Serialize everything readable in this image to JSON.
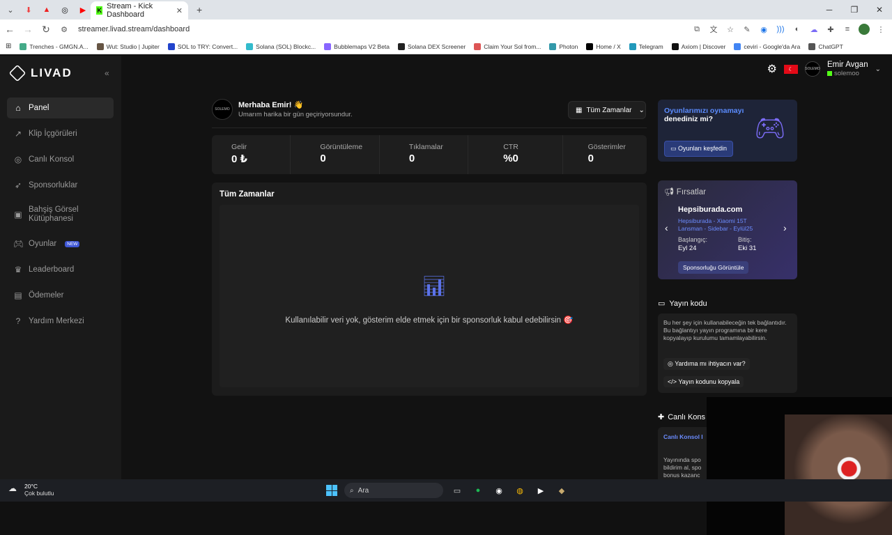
{
  "browser": {
    "tab_title": "Stream - Kick Dashboard",
    "url": "streamer.livad.stream/dashboard",
    "bookmarks": [
      "Trenches - GMGN.A...",
      "Wut: Studio | Jupiter",
      "SOL to TRY: Convert...",
      "Solana (SOL) Blockc...",
      "Bubblemaps V2 Beta",
      "Solana DEX Screener",
      "Claim Your Sol from...",
      "Photon",
      "Home / X",
      "Telegram",
      "Axiom | Discover",
      "ceviri - Google'da Ara",
      "ChatGPT"
    ]
  },
  "brand": "LIVAD",
  "sidebar": {
    "items": [
      {
        "label": "Panel",
        "icon": "home-icon"
      },
      {
        "label": "Klip İçgörüleri",
        "icon": "trend-icon"
      },
      {
        "label": "Canlı Konsol",
        "icon": "target-icon"
      },
      {
        "label": "Sponsorluklar",
        "icon": "rocket-icon"
      },
      {
        "label": "Bahşiş Görsel Kütüphanesi",
        "icon": "image-icon"
      },
      {
        "label": "Oyunlar",
        "icon": "gamepad-icon",
        "badge": "NEW"
      },
      {
        "label": "Leaderboard",
        "icon": "trophy-icon"
      },
      {
        "label": "Ödemeler",
        "icon": "wallet-icon"
      },
      {
        "label": "Yardım Merkezi",
        "icon": "help-icon"
      }
    ]
  },
  "user": {
    "name": "Emir Avgan",
    "handle": "solemoo",
    "avatar_text": "SOLEMO"
  },
  "greeting": {
    "title": "Merhaba Emir! 👋",
    "subtitle": "Umarım harika bir gün geçiriyorsundur."
  },
  "range_selector": "Tüm Zamanlar",
  "stats": [
    {
      "label": "Gelir",
      "value": "0 ₺"
    },
    {
      "label": "Görüntüleme",
      "value": "0"
    },
    {
      "label": "Tıklamalar",
      "value": "0"
    },
    {
      "label": "CTR",
      "value": "%0"
    },
    {
      "label": "Gösterimler",
      "value": "0"
    }
  ],
  "panel": {
    "title": "Tüm Zamanlar",
    "empty_text": "Kullanılabilir veri yok, gösterim elde etmek için bir sponsorluk kabul edebilirsin 🎯"
  },
  "promo": {
    "highlight": "Oyunlarımızı oynamayı",
    "rest": " denediniz mi?",
    "button": "Oyunları keşfedin"
  },
  "opportunities": {
    "title": "Fırsatlar",
    "brand": "Hepsiburada.com",
    "campaign": "Hepsiburada - Xiaomi 15T Lansman - Sidebar - Eylül25",
    "start_label": "Başlangıç:",
    "start_date": "Eyl 24",
    "end_label": "Bitiş:",
    "end_date": "Eki 31",
    "button": "Sponsorluğu Görüntüle"
  },
  "stream_code": {
    "title": "Yayın kodu",
    "desc": "Bu her şey için kullanabileceğin tek bağlantıdır. Bu bağlantıyı yayın programına bir kere kopyalayıp kurulumu tamamlayabilirsin.",
    "help": "Yardıma mı ihtiyacın var?",
    "copy": "Yayın kodunu kopyala"
  },
  "live_console": {
    "title": "Canlı Kons",
    "link": "Canlı Konsol I",
    "desc1": "Yayınında spo",
    "desc2": "bildirim al, spo",
    "desc3": "bonus kazanc"
  },
  "taskbar": {
    "temp": "20°C",
    "weather": "Çok bulutlu",
    "search": "Ara"
  }
}
